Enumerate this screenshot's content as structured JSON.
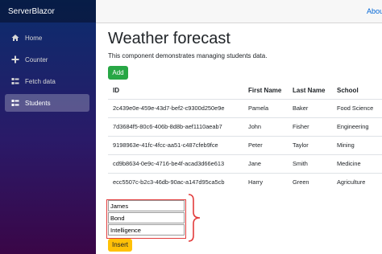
{
  "sidebar": {
    "brand": "ServerBlazor",
    "items": [
      {
        "label": "Home",
        "icon": "home-icon"
      },
      {
        "label": "Counter",
        "icon": "plus-icon"
      },
      {
        "label": "Fetch data",
        "icon": "list-icon"
      },
      {
        "label": "Students",
        "icon": "list-icon",
        "active": true
      }
    ]
  },
  "topbar": {
    "link": "Abou"
  },
  "main": {
    "title": "Weather forecast",
    "description": "This component demonstrates managing students data.",
    "add_label": "Add",
    "columns": [
      "ID",
      "First Name",
      "Last Name",
      "School"
    ],
    "rows": [
      {
        "id": "2c439e0e-459e-43d7-bef2-c9300d250e9e",
        "first": "Pamela",
        "last": "Baker",
        "school": "Food Science"
      },
      {
        "id": "7d3684f5-80c6-406b-8d8b-aef1110aeab7",
        "first": "John",
        "last": "Fisher",
        "school": "Engineering"
      },
      {
        "id": "9198963e-41fc-4fcc-aa51-c487cfeb9fce",
        "first": "Peter",
        "last": "Taylor",
        "school": "Mining"
      },
      {
        "id": "cd9b8634-0e9c-4716-be4f-acad3d66e613",
        "first": "Jane",
        "last": "Smith",
        "school": "Medicine"
      },
      {
        "id": "ecc5507c-b2c3-46db-90ac-a147d95ca5cb",
        "first": "Harry",
        "last": "Green",
        "school": "Agriculture"
      }
    ],
    "form": {
      "first_value": "James",
      "last_value": "Bond",
      "school_value": "Intelligence",
      "insert_label": "Insert"
    }
  },
  "colors": {
    "add_button": "#28a745",
    "insert_button": "#ffc107",
    "annotation": "#e23b3b",
    "link": "#0366d6"
  }
}
